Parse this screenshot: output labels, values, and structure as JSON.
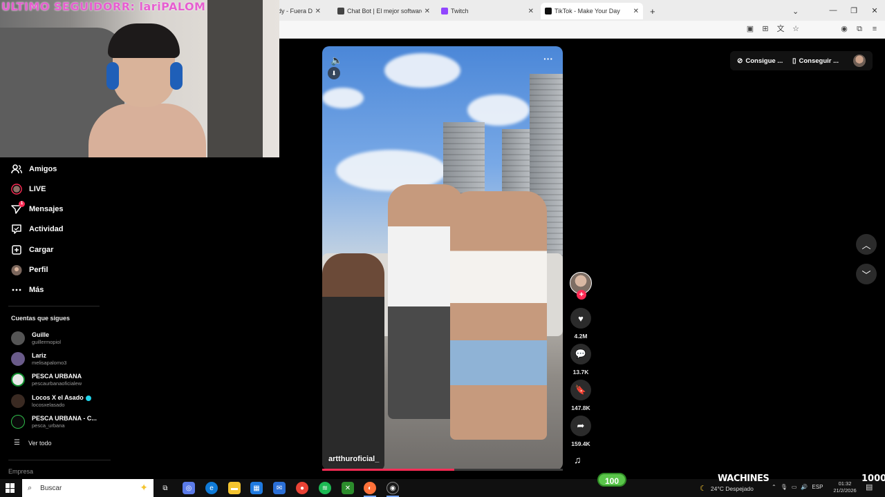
{
  "stream_overlay": {
    "webcam_title": "ULTIMO SEGUIDORR: lariPALOM",
    "badge_100": "100",
    "banner_text": "WACHINES",
    "counter_text": "1000"
  },
  "browser": {
    "tabs": [
      {
        "title": "dy - Fuera Del P",
        "icon": "music-icon",
        "color": "#6b7bb8"
      },
      {
        "title": "Chat Bot | El mejor software pa",
        "icon": "chat-icon",
        "color": "#444444"
      },
      {
        "title": "Twitch",
        "icon": "twitch-icon",
        "color": "#9146ff"
      },
      {
        "title": "TikTok - Make Your Day",
        "icon": "tiktok-icon",
        "color": "#111111"
      }
    ],
    "new_tab_symbol": "+",
    "dropdown_symbol": "⌄"
  },
  "sidebar": {
    "nav": [
      {
        "label": "Amigos",
        "icon": "friends-icon"
      },
      {
        "label": "LIVE",
        "icon": "live-icon"
      },
      {
        "label": "Mensajes",
        "icon": "messages-icon",
        "badge": "1"
      },
      {
        "label": "Actividad",
        "icon": "activity-icon"
      },
      {
        "label": "Cargar",
        "icon": "upload-icon"
      },
      {
        "label": "Perfil",
        "icon": "profile-icon"
      },
      {
        "label": "Más",
        "icon": "more-icon"
      }
    ],
    "following_title": "Cuentas que sigues",
    "following": [
      {
        "name": "Guille",
        "username": "guillermopiol",
        "avatar_color": "#555555"
      },
      {
        "name": "Lariz",
        "username": "melisapalomo3",
        "avatar_color": "#6a5b8a"
      },
      {
        "name": "PESCA URBANA",
        "username": "pescaurbanaoficialew",
        "avatar_color": "#e8e8e8"
      },
      {
        "name": "Locos X el Asado",
        "username": "locosxelasado",
        "avatar_color": "#3a2a22",
        "verified": true
      },
      {
        "name": "PESCA URBANA - C...",
        "username": "pesca_urbana",
        "avatar_color": "#0a0a0a"
      }
    ],
    "see_all": "Ver todo",
    "company": "Empresa"
  },
  "video": {
    "author": "artthuroficial_",
    "progress_fraction": 0.55,
    "likes": "4.2M",
    "comments": "13.7K",
    "saves": "147.8K",
    "shares": "159.4K"
  },
  "top_right": {
    "coins_label": "Consigue ...",
    "app_label": "Conseguir ..."
  },
  "taskbar": {
    "search_label": "Buscar",
    "weather": "24°C  Despejado",
    "lang": "ESP",
    "time": "01:32",
    "date": "21/2/2026"
  }
}
